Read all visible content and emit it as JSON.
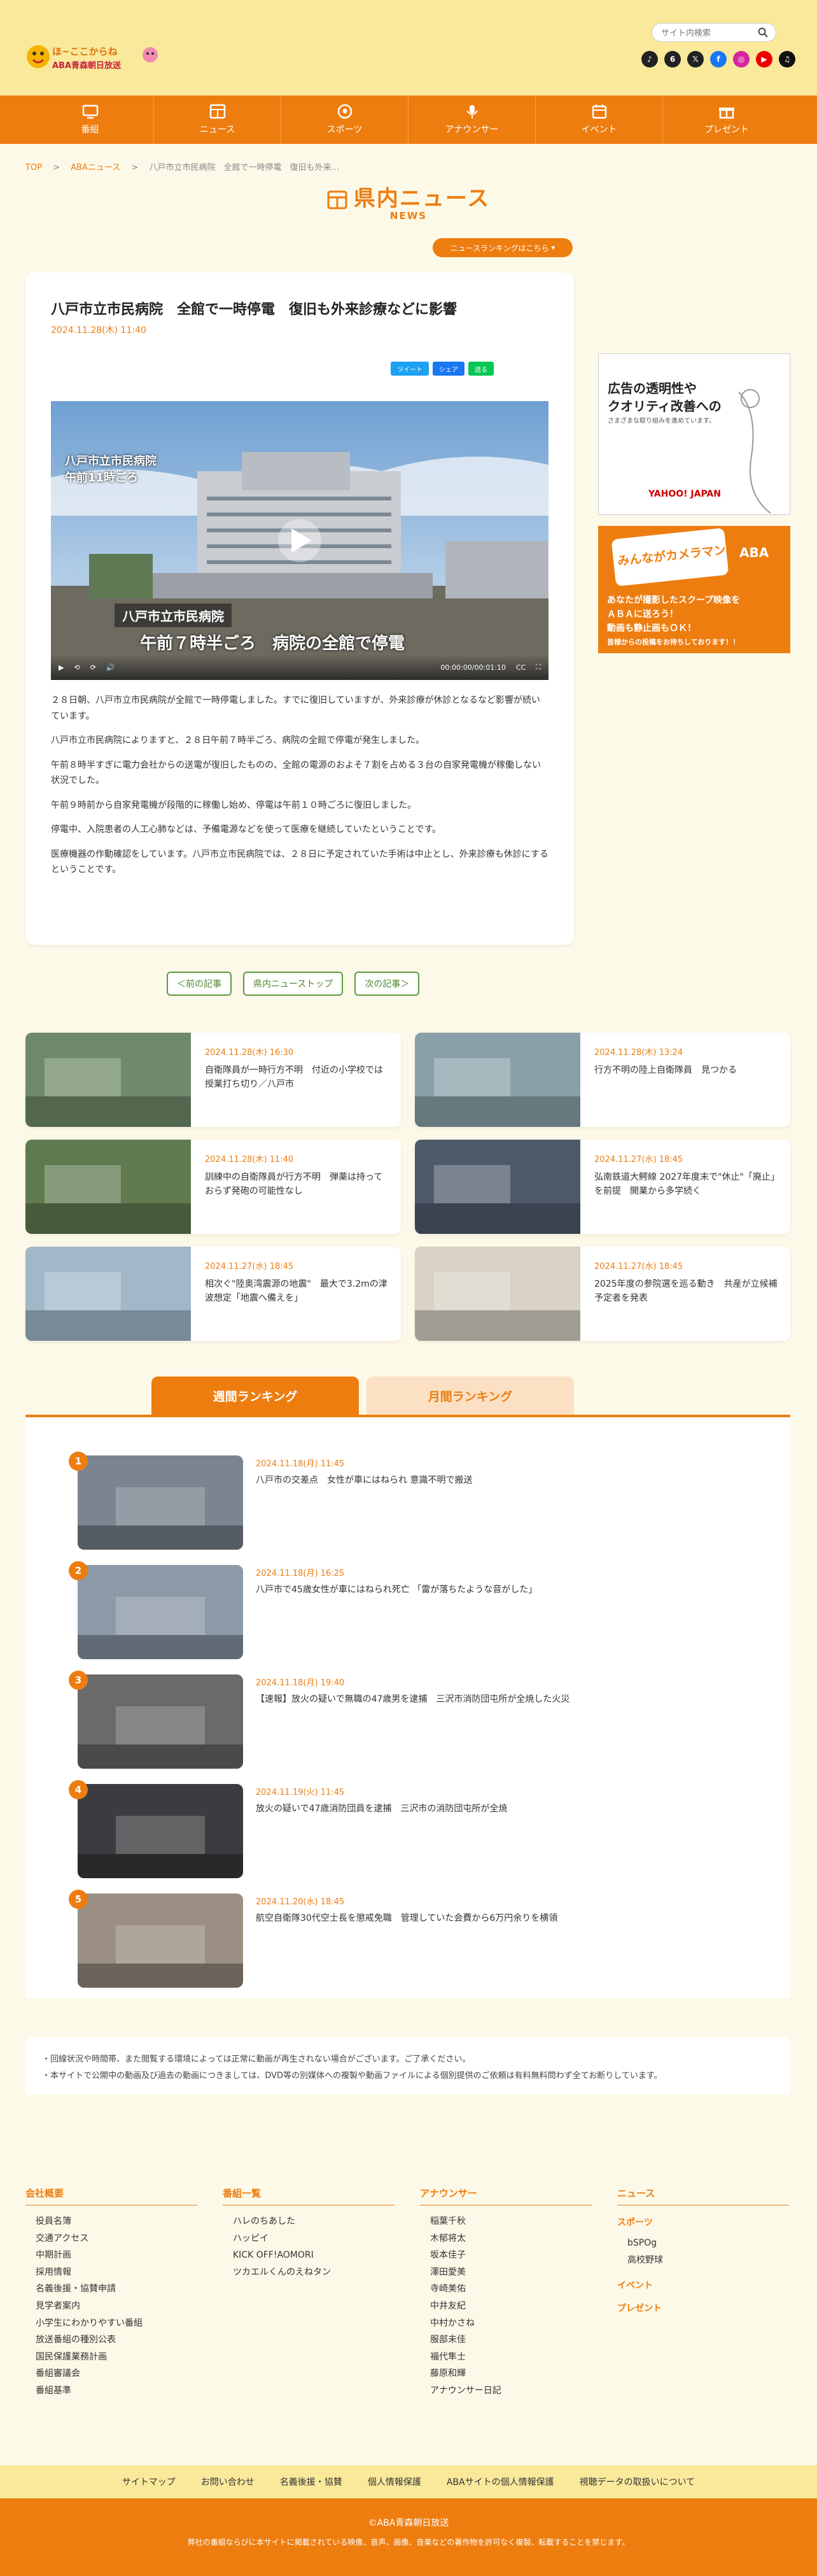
{
  "header": {
    "logo_line1": "ほ~ここからね",
    "logo_line2": "ABA青森朝日放送",
    "search_placeholder": "サイト内検索",
    "social": [
      {
        "name": "tiktok-icon",
        "glyph": "♪",
        "color": "#222"
      },
      {
        "name": "6-icon",
        "glyph": "6",
        "color": "#222"
      },
      {
        "name": "x-icon",
        "glyph": "𝕏",
        "color": "#222"
      },
      {
        "name": "facebook-icon",
        "glyph": "f",
        "color": "#1877f2"
      },
      {
        "name": "instagram-icon",
        "glyph": "◎",
        "color": "#d6249f"
      },
      {
        "name": "youtube-icon",
        "glyph": "▶",
        "color": "#e00"
      },
      {
        "name": "tiktok2-icon",
        "glyph": "♫",
        "color": "#111"
      }
    ]
  },
  "nav": [
    {
      "label": "番組",
      "icon": "tv"
    },
    {
      "label": "ニュース",
      "icon": "news"
    },
    {
      "label": "スポーツ",
      "icon": "ball"
    },
    {
      "label": "アナウンサー",
      "icon": "mic"
    },
    {
      "label": "イベント",
      "icon": "calendar"
    },
    {
      "label": "プレゼント",
      "icon": "gift"
    }
  ],
  "breadcrumb": {
    "top": "TOP",
    "news": "ABAニュース",
    "current": "八戸市立市民病院　全館で一時停電　復旧も外来…"
  },
  "page": {
    "title": "県内ニュース",
    "subtitle": "NEWS",
    "ranking_button": "ニュースランキングはこちら"
  },
  "article": {
    "title": "八戸市立市民病院　全館で一時停電　復旧も外来診療などに影響",
    "date": "2024.11.28(木) 11:40",
    "share": [
      {
        "label": "ツイート",
        "color": "#1da1f2"
      },
      {
        "label": "シェア",
        "color": "#1877f2"
      },
      {
        "label": "送る",
        "color": "#06c755"
      }
    ],
    "video": {
      "caption_main": "午前７時半ごろ　病院の全館で停電",
      "caption_place": "八戸市立市民病院",
      "caption_corner": "八戸市立市民病院\n午前11時ごろ",
      "time": "00:00:00/00:01:10"
    },
    "paragraphs": [
      "２８日朝、八戸市立市民病院が全館で一時停電しました。すでに復旧していますが、外来診療が休診となるなど影響が続いています。",
      "八戸市立市民病院によりますと、２８日午前７時半ごろ、病院の全館で停電が発生しました。",
      "午前８時半すぎに電力会社からの送電が復旧したものの、全館の電源のおよそ７割を占める３台の自家発電機が稼働しない状況でした。",
      "午前９時前から自家発電機が段階的に稼働し始め、停電は午前１０時ごろに復旧しました。",
      "停電中、入院患者の人工心肺などは、予備電源などを使って医療を継続していたということです。",
      "医療機器の作動確認をしています。八戸市立市民病院では、２８日に予定されていた手術は中止とし、外来診療も休診にするということです。"
    ]
  },
  "pager": {
    "prev": "＜前の記事",
    "top": "県内ニューストップ",
    "next": "次の記事＞"
  },
  "ads": {
    "ad1_line1": "広告の透明性や",
    "ad1_line2": "クオリティ改善への",
    "ad1_line3": "さまざまな取り組みを進めています。",
    "ad1_brand": "YAHOO! JAPAN",
    "ad2_title": "みんながカメラマン",
    "ad2_brand": "ABA",
    "ad2_line1": "あなたが撮影したスクープ映像を",
    "ad2_line2": "ＡＢＡに送ろう！",
    "ad2_line3": "動画も静止画もＯＫ！",
    "ad2_line4": "皆様からの投稿をお待ちしております！！"
  },
  "related": [
    {
      "date": "2024.11.28(木) 16:30",
      "title": "自衛隊員が一時行方不明　付近の小学校では授業打ち切り／八戸市",
      "thumb": "#6f8a6a"
    },
    {
      "date": "2024.11.28(木) 13:24",
      "title": "行方不明の陸上自衛隊員　見つかる",
      "thumb": "#8aa0a8"
    },
    {
      "date": "2024.11.28(木) 11:40",
      "title": "訓練中の自衛隊員が行方不明　弾薬は持っておらず発砲の可能性なし",
      "thumb": "#5f7a4e"
    },
    {
      "date": "2024.11.27(水) 18:45",
      "title": "弘南鉄道大鰐線 2027年度末で\"休止\"「廃止」を前提　開業から多学続く",
      "thumb": "#4e5a6a"
    },
    {
      "date": "2024.11.27(水) 18:45",
      "title": "相次ぐ\"陸奥湾震源の地震\"　最大で3.2mの津波想定「地震へ備えを」",
      "thumb": "#a0b8c8"
    },
    {
      "date": "2024.11.27(水) 18:45",
      "title": "2025年度の参院選を巡る動き　共産が立候補予定者を発表",
      "thumb": "#d8d2c4"
    }
  ],
  "ranking": {
    "tab_weekly": "週間ランキング",
    "tab_monthly": "月間ランキング",
    "items": [
      {
        "rank": "1",
        "date": "2024.11.18(月) 11:45",
        "title": "八戸市の交差点　女性が車にはねられ 意識不明で搬送",
        "thumb": "#7a8590"
      },
      {
        "rank": "2",
        "date": "2024.11.18(月) 16:25",
        "title": "八戸市で45歳女性が車にはねられ死亡 「雷が落ちたような音がした」",
        "thumb": "#8c9aa8"
      },
      {
        "rank": "3",
        "date": "2024.11.18(月) 19:40",
        "title": "【速報】放火の疑いで無職の47歳男を逮捕　三沢市消防団屯所が全焼した火災",
        "thumb": "#6a6a6a"
      },
      {
        "rank": "4",
        "date": "2024.11.19(火) 11:45",
        "title": "放火の疑いで47歳消防団員を逮捕　三沢市の消防団屯所が全焼",
        "thumb": "#3c3c40"
      },
      {
        "rank": "5",
        "date": "2024.11.20(水) 18:45",
        "title": "航空自衛隊30代空士長を懲戒免職　管理していた会費から6万円余りを横領",
        "thumb": "#9a8f82"
      }
    ]
  },
  "notice": {
    "line1": "・回線状況や時間帯、また閲覧する環境によっては正常に動画が再生されない場合がございます。ご了承ください。",
    "line2": "・本サイトで公開中の動画及び過去の動画につきましては、DVD等の別媒体への複製や動画ファイルによる個別提供のご依頼は有料無料問わず全てお断りしています。"
  },
  "footer": {
    "col1_title": "会社概要",
    "col1": [
      "役員名簿",
      "交通アクセス",
      "中期計画",
      "採用情報",
      "名義後援・協賛申請",
      "見学者案内",
      "小学生にわかりやすい番組",
      "放送番組の種別公表",
      "国民保護業務計画",
      "番組審議会",
      "番組基準"
    ],
    "col2_title": "番組一覧",
    "col2": [
      "ハレのちあした",
      "ハッピイ",
      "KICK OFF!AOMORI",
      "ツカエルくんのえねタン"
    ],
    "col3_title": "アナウンサー",
    "col3": [
      "稲葉千秋",
      "木郁将太",
      "坂本佳子",
      "澤田愛美",
      "寺崎美佑",
      "中井友紀",
      "中村かさね",
      "服部未佳",
      "福代隼士",
      "藤原和輝",
      "アナウンサー日記"
    ],
    "col4_title": "ニュース",
    "col4_sub1": "スポーツ",
    "col4_sub1_items": [
      "bSPOg",
      "高校野球"
    ],
    "col4_sub2": "イベント",
    "col4_sub3": "プレゼント",
    "bar": [
      "サイトマップ",
      "お問い合わせ",
      "名義後援・協賛",
      "個人情報保護",
      "ABAサイトの個人情報保護",
      "視聴データの取扱いについて"
    ],
    "copyright": "©ABA青森朝日放送",
    "disclaimer": "弊社の番組ならびに本サイトに掲載されている映像、音声、画像、音楽などの著作物を許可なく複製、転載することを禁じます。"
  }
}
